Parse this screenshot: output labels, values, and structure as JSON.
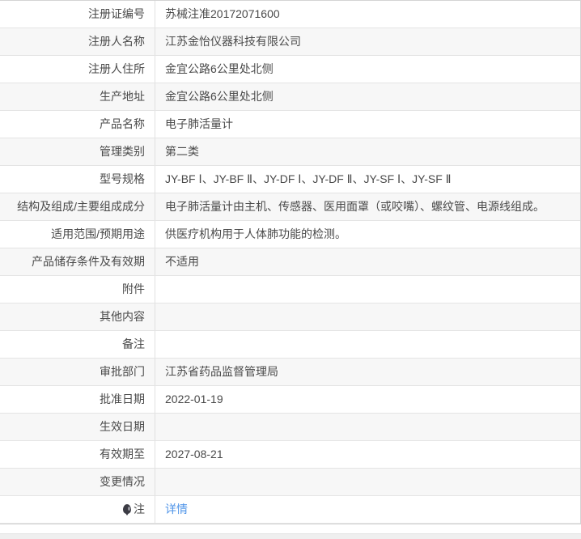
{
  "table": {
    "rows": [
      {
        "label": "注册证编号",
        "value": "苏械注准20172071600"
      },
      {
        "label": "注册人名称",
        "value": "江苏金怡仪器科技有限公司"
      },
      {
        "label": "注册人住所",
        "value": "金宜公路6公里处北侧"
      },
      {
        "label": "生产地址",
        "value": "金宜公路6公里处北侧"
      },
      {
        "label": "产品名称",
        "value": "电子肺活量计"
      },
      {
        "label": "管理类别",
        "value": "第二类"
      },
      {
        "label": "型号规格",
        "value": "JY-BF Ⅰ、JY-BF Ⅱ、JY-DF Ⅰ、JY-DF Ⅱ、JY-SF Ⅰ、JY-SF Ⅱ"
      },
      {
        "label": "结构及组成/主要组成成分",
        "value": "电子肺活量计由主机、传感器、医用面罩（或咬嘴）、螺纹管、电源线组成。"
      },
      {
        "label": "适用范围/预期用途",
        "value": "供医疗机构用于人体肺功能的检测。"
      },
      {
        "label": "产品储存条件及有效期",
        "value": "不适用"
      },
      {
        "label": "附件",
        "value": ""
      },
      {
        "label": "其他内容",
        "value": ""
      },
      {
        "label": "备注",
        "value": ""
      },
      {
        "label": "审批部门",
        "value": "江苏省药品监督管理局"
      },
      {
        "label": "批准日期",
        "value": "2022-01-19"
      },
      {
        "label": "生效日期",
        "value": ""
      },
      {
        "label": "有效期至",
        "value": "2027-08-21"
      },
      {
        "label": "变更情况",
        "value": ""
      },
      {
        "label": "注",
        "value": "详情",
        "link": true,
        "icon": "note-balloon-icon"
      }
    ]
  },
  "colors": {
    "link_blue": "#4f94e8",
    "stripe_gray": "#f7f7f7",
    "outer_border": "#d4d4d4",
    "row_border": "#e4e4e4",
    "footer_gray": "#efefef",
    "text": "#4a4a4a"
  }
}
